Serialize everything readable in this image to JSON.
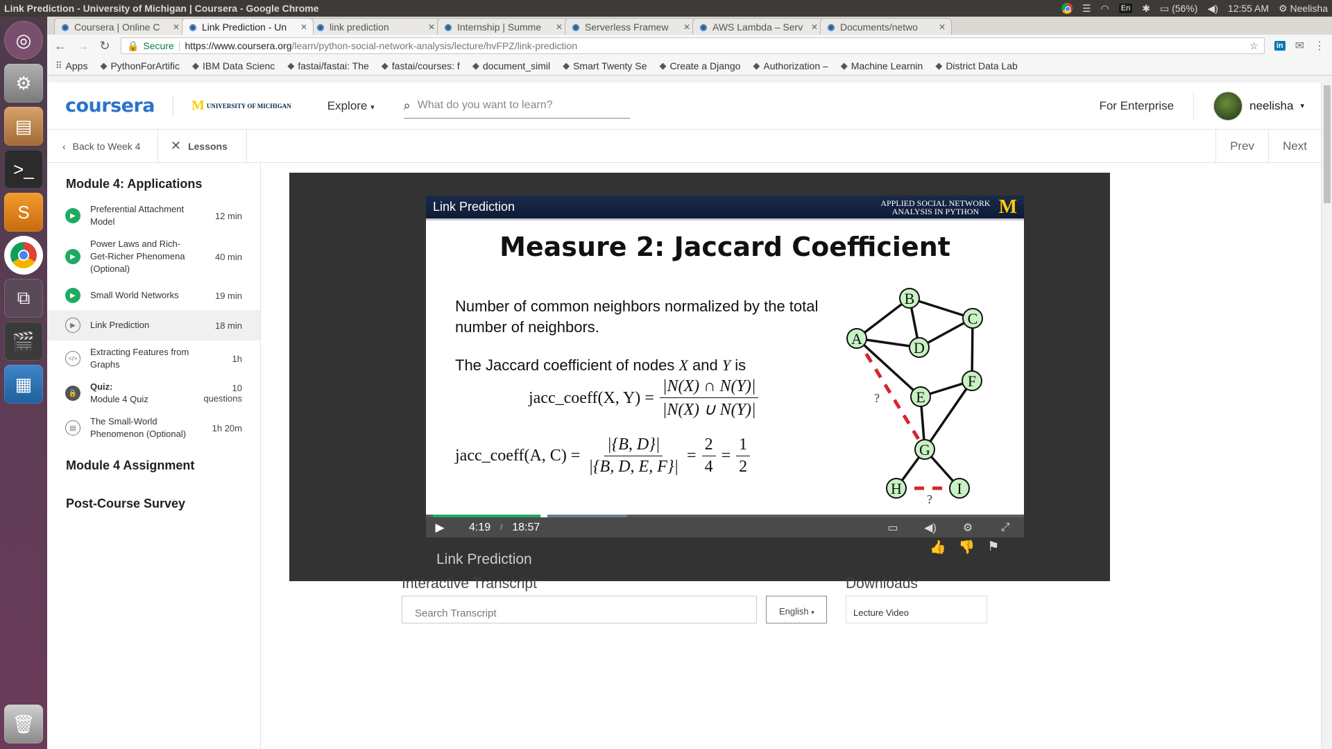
{
  "os": {
    "window_title": "Link Prediction - University of Michigan | Coursera - Google Chrome",
    "keyboard": "En",
    "battery": "(56%)",
    "time": "12:55 AM",
    "user": "Neelisha"
  },
  "tabs": [
    {
      "title": "Coursera | Online C",
      "active": false
    },
    {
      "title": "Link Prediction - Un",
      "active": true
    },
    {
      "title": "link prediction",
      "active": false
    },
    {
      "title": "Internship | Summe",
      "active": false
    },
    {
      "title": "Serverless Framew",
      "active": false
    },
    {
      "title": "AWS Lambda – Serv",
      "active": false
    },
    {
      "title": "Documents/netwo",
      "active": false
    }
  ],
  "omnibox": {
    "secure_label": "Secure",
    "url_host": "https://www.coursera.org",
    "url_path": "/learn/python-social-network-analysis/lecture/hvFPZ/link-prediction"
  },
  "bookmarks": [
    "Apps",
    "PythonForArtific",
    "IBM Data Scienc",
    "fastai/fastai: The",
    "fastai/courses: f",
    "document_simil",
    "Smart Twenty Se",
    "Create a Django",
    "Authorization –",
    "Machine Learnin",
    "District Data Lab"
  ],
  "header": {
    "logo": "coursera",
    "partner_m": "M",
    "partner_name": "UNIVERSITY OF MICHIGAN",
    "explore_label": "Explore",
    "search_placeholder": "What do you want to learn?",
    "enterprise_label": "For Enterprise",
    "username": "neelisha"
  },
  "subnav": {
    "back_label": "Back to Week 4",
    "lessons_label": "Lessons",
    "prev_label": "Prev",
    "next_label": "Next"
  },
  "sidebar": {
    "module_title": "Module 4: Applications",
    "items": [
      {
        "name": "Preferential Attachment Model",
        "duration": "12 min",
        "status": "done"
      },
      {
        "name": "Power Laws and Rich-Get-Richer Phenomena (Optional)",
        "duration": "40 min",
        "status": "done"
      },
      {
        "name": "Small World Networks",
        "duration": "19 min",
        "status": "done"
      },
      {
        "name": "Link Prediction",
        "duration": "18 min",
        "status": "current"
      },
      {
        "name": "Extracting Features from Graphs",
        "duration": "1h",
        "status": "code"
      },
      {
        "name_prefix": "Quiz:",
        "name": "Module 4 Quiz",
        "duration": "10 questions",
        "status": "locked"
      },
      {
        "name": "The Small-World Phenomenon (Optional)",
        "duration": "1h 20m",
        "status": "reading"
      }
    ],
    "assignment": "Module 4 Assignment",
    "survey": "Post-Course Survey"
  },
  "slide": {
    "band_title": "Link Prediction",
    "band_course_line1": "APPLIED SOCIAL NETWORK",
    "band_course_line2": "ANALYSIS IN PYTHON",
    "band_logo": "M",
    "title": "Measure 2: Jaccard Coefficient",
    "text1": "Number of common neighbors normalized by the total number of neighbors.",
    "text2_pre": "The Jaccard coefficient of nodes ",
    "text2_x": "X",
    "text2_mid": " and ",
    "text2_y": "Y",
    "text2_post": " is",
    "eq1_lhs": "jacc_coeff(X, Y) =",
    "eq1_num": "|N(X) ∩ N(Y)|",
    "eq1_den": "|N(X) ∪ N(Y)|",
    "eq2_lhs": "jacc_coeff(A, C) =",
    "eq2_num": "|{B, D}|",
    "eq2_den": "|{B, D, E, F}|",
    "eq2_eq": "=",
    "eq2_n2": "2",
    "eq2_d2": "4",
    "eq2_eq2": "=",
    "eq2_n3": "1",
    "eq2_d3": "2",
    "graph_nodes": [
      "A",
      "B",
      "C",
      "D",
      "E",
      "F",
      "G",
      "H",
      "I"
    ],
    "graph_question_mark": "?"
  },
  "player": {
    "current_time": "4:19",
    "separator": "/",
    "duration": "18:57",
    "played_fraction": 0.228,
    "buffered_fraction": 0.4,
    "video_title": "Link Prediction"
  },
  "below": {
    "transcript_heading": "Interactive Transcript",
    "transcript_search_placeholder": "Search Transcript",
    "language": "English",
    "downloads_heading": "Downloads",
    "downloads_first": "Lecture Video"
  }
}
